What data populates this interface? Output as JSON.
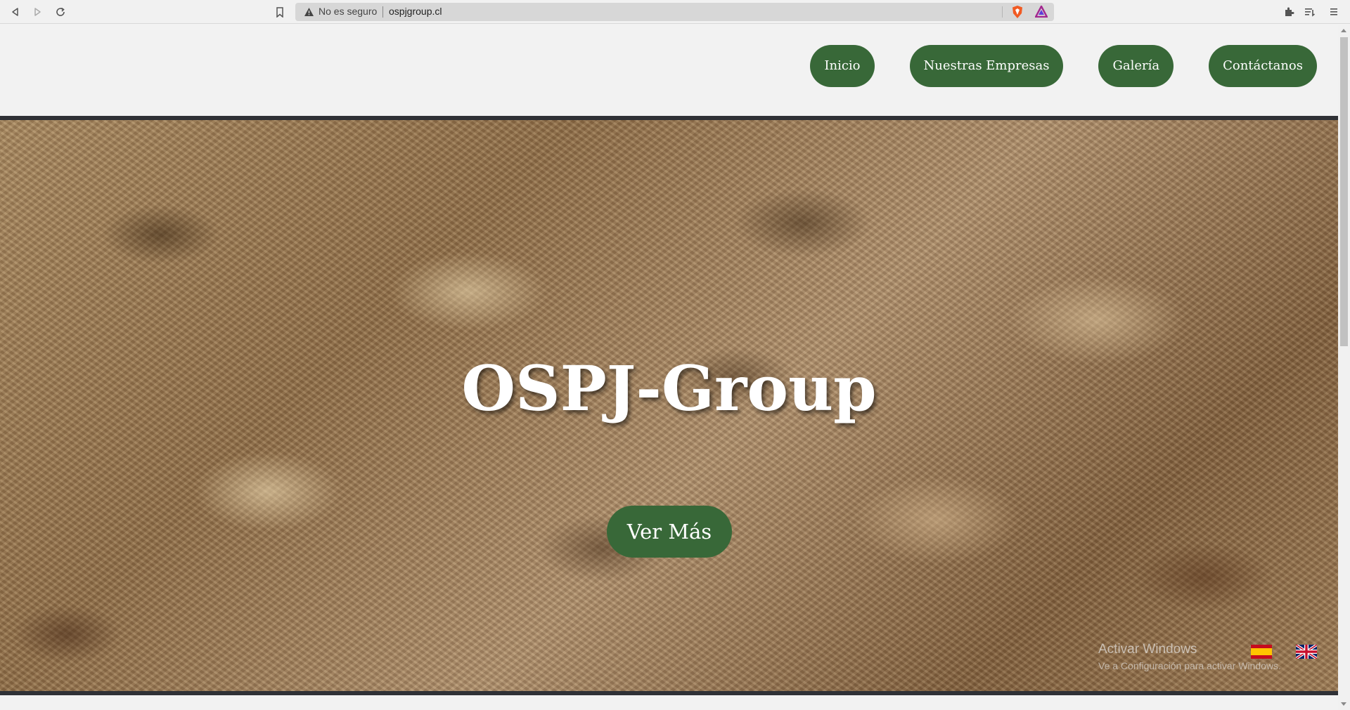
{
  "browser": {
    "security_label": "No es seguro",
    "url": "ospjgroup.cl",
    "icons": [
      "back-icon",
      "forward-icon",
      "reload-icon",
      "bookmark-icon",
      "warning-icon",
      "brave-shield-icon",
      "brave-rewards-icon",
      "extensions-icon",
      "reading-list-icon",
      "menu-icon"
    ]
  },
  "nav": {
    "items": [
      {
        "label": "Inicio"
      },
      {
        "label": "Nuestras Empresas"
      },
      {
        "label": "Galería"
      },
      {
        "label": "Contáctanos"
      }
    ]
  },
  "hero": {
    "title": "OSPJ-Group",
    "cta_label": "Ver Más"
  },
  "watermark": {
    "title": "Activar Windows",
    "subtitle": "Ve a Configuración para activar Windows."
  },
  "language_flags": [
    "spain-flag-icon",
    "uk-flag-icon"
  ],
  "colors": {
    "accent_green": "#386838",
    "divider": "#2f3136"
  }
}
